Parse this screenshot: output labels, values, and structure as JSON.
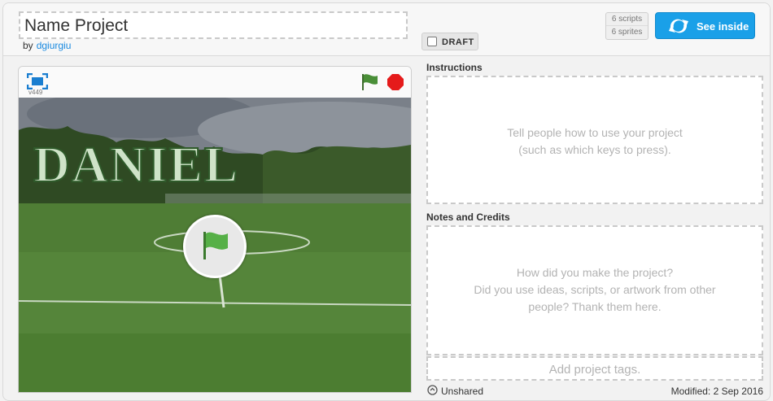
{
  "header": {
    "title": "Name Project",
    "by_label": "by",
    "author": "dgiurgiu",
    "draft_label": "DRAFT",
    "scripts": "6 scripts",
    "sprites": "6 sprites",
    "see_inside": "See inside"
  },
  "player": {
    "version": "v449",
    "stage_text": "DANIEL"
  },
  "instructions": {
    "heading": "Instructions",
    "placeholder_line1": "Tell people how to use your project",
    "placeholder_line2": "(such as which keys to press)."
  },
  "notes": {
    "heading": "Notes and Credits",
    "placeholder_line1": "How did you make the project?",
    "placeholder_line2": "Did you use ideas, scripts, or artwork from other",
    "placeholder_line3": "people? Thank them here."
  },
  "tags": {
    "placeholder": "Add project tags."
  },
  "footer": {
    "status": "Unshared",
    "modified": "Modified: 2 Sep 2016"
  },
  "colors": {
    "accent": "#1aa0e8",
    "link": "#1a8ae0",
    "flag_green": "#4caf50",
    "stop_red": "#e51b1b"
  }
}
